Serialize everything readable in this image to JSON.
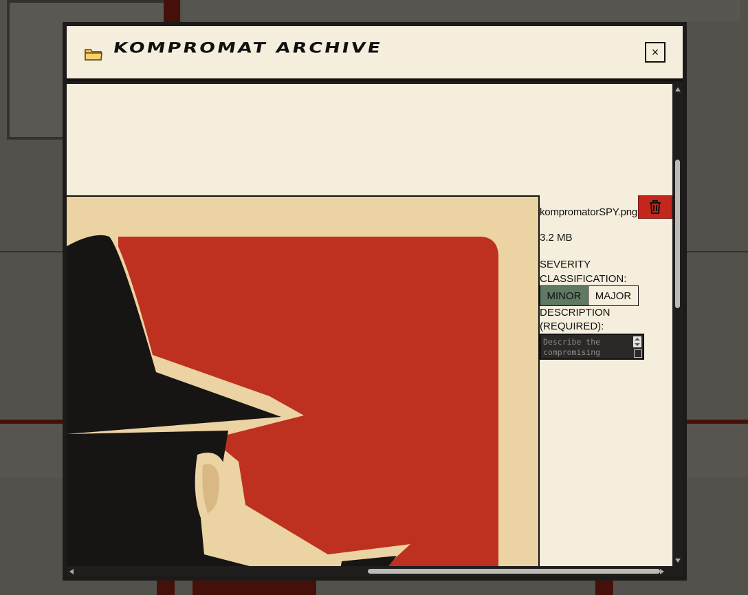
{
  "modal": {
    "title": "KOMPROMAT ARCHIVE",
    "close_label": "×"
  },
  "file": {
    "name": "kompromatorSPY.png",
    "size": "3.2 MB"
  },
  "severity": {
    "label": "SEVERITY CLASSIFICATION:",
    "options": [
      "MINOR",
      "MAJOR"
    ],
    "selected": "MINOR"
  },
  "description": {
    "label": "DESCRIPTION (REQUIRED):",
    "placeholder": "Describe the compromising"
  },
  "icons": {
    "title": "folder-icon",
    "close": "close-icon",
    "delete": "trash-icon"
  },
  "colors": {
    "panel": "#f5eedd",
    "frame": "#1c1b1a",
    "accent_red": "#c3271c",
    "selected_green": "#5f7a62",
    "poster_red": "#be301f",
    "poster_cream": "#ecd3a4"
  }
}
